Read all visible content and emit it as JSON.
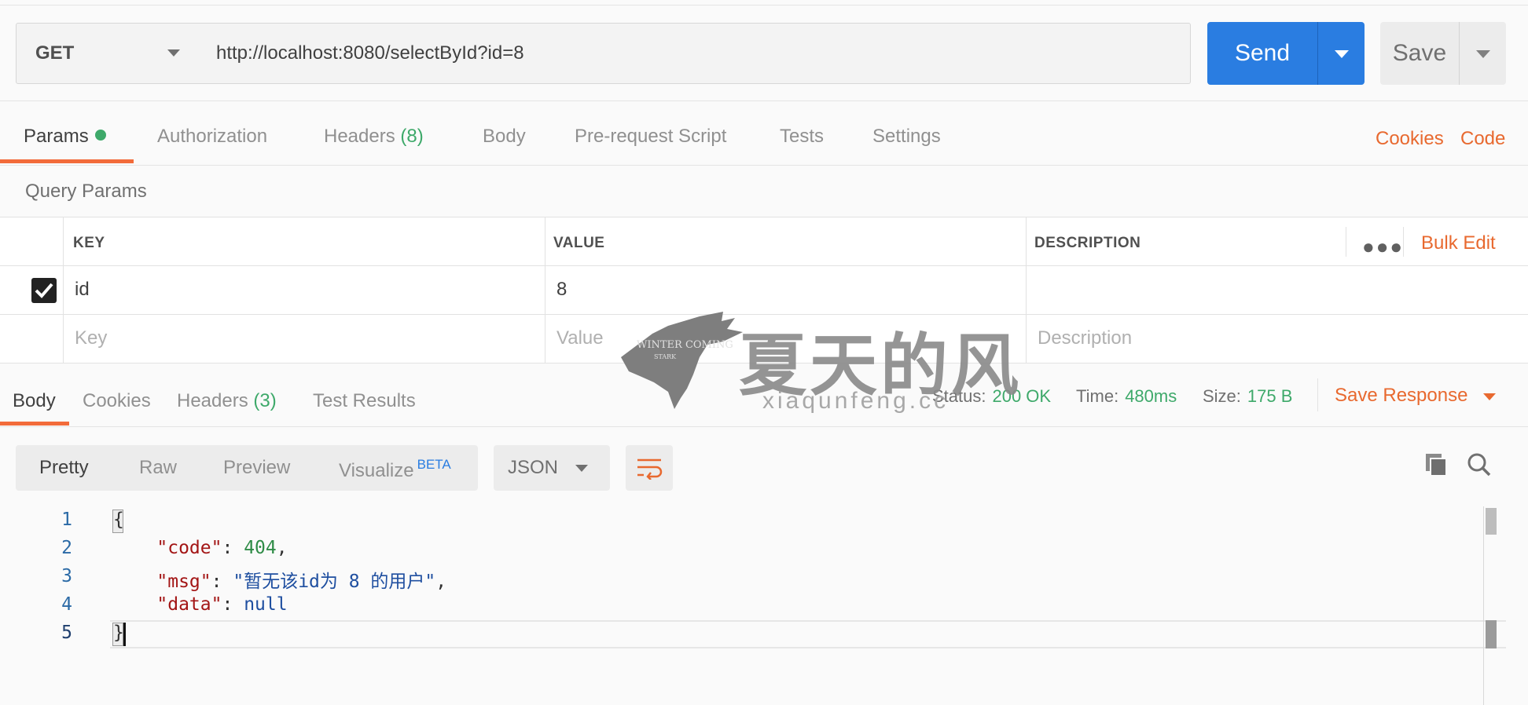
{
  "request": {
    "method": "GET",
    "url": "http://localhost:8080/selectById?id=8",
    "send_label": "Send",
    "save_label": "Save"
  },
  "request_tabs": [
    {
      "label": "Params",
      "active": true
    },
    {
      "label": "Authorization"
    },
    {
      "label": "Headers",
      "count": "(8)"
    },
    {
      "label": "Body"
    },
    {
      "label": "Pre-request Script"
    },
    {
      "label": "Tests"
    },
    {
      "label": "Settings"
    }
  ],
  "links": {
    "cookies": "Cookies",
    "code": "Code"
  },
  "query_params": {
    "title": "Query Params",
    "headers": {
      "key": "KEY",
      "value": "VALUE",
      "description": "DESCRIPTION"
    },
    "bulk_edit": "Bulk Edit",
    "rows": [
      {
        "checked": true,
        "key": "id",
        "value": "8",
        "description": ""
      }
    ],
    "placeholders": {
      "key": "Key",
      "value": "Value",
      "description": "Description"
    }
  },
  "response_tabs": [
    {
      "label": "Body",
      "active": true
    },
    {
      "label": "Cookies"
    },
    {
      "label": "Headers",
      "count": "(3)"
    },
    {
      "label": "Test Results"
    }
  ],
  "response_meta": {
    "status_label": "Status:",
    "status_value": "200 OK",
    "time_label": "Time:",
    "time_value": "480ms",
    "size_label": "Size:",
    "size_value": "175 B",
    "save_response": "Save Response"
  },
  "view": {
    "options": [
      "Pretty",
      "Raw",
      "Preview",
      "Visualize"
    ],
    "beta": "BETA",
    "format": "JSON"
  },
  "code": {
    "line_numbers": [
      "1",
      "2",
      "3",
      "4",
      "5"
    ],
    "open_brace": "{",
    "close_brace": "}",
    "lines": [
      {
        "key": "\"code\"",
        "value": "404",
        "kind": "number"
      },
      {
        "key": "\"msg\"",
        "value": "\"暂无该id为 8 的用户\"",
        "kind": "string"
      },
      {
        "key": "\"data\"",
        "value": "null",
        "kind": "literal"
      }
    ]
  },
  "watermark": {
    "badge_text": "WINTER COMING",
    "badge_small": "STARK",
    "title": "夏天的风",
    "subtitle": "xiaqunfeng.cc"
  },
  "colors": {
    "accent_orange": "#f26b3a",
    "send_blue": "#2a7de1",
    "status_green": "#3ea96a"
  }
}
